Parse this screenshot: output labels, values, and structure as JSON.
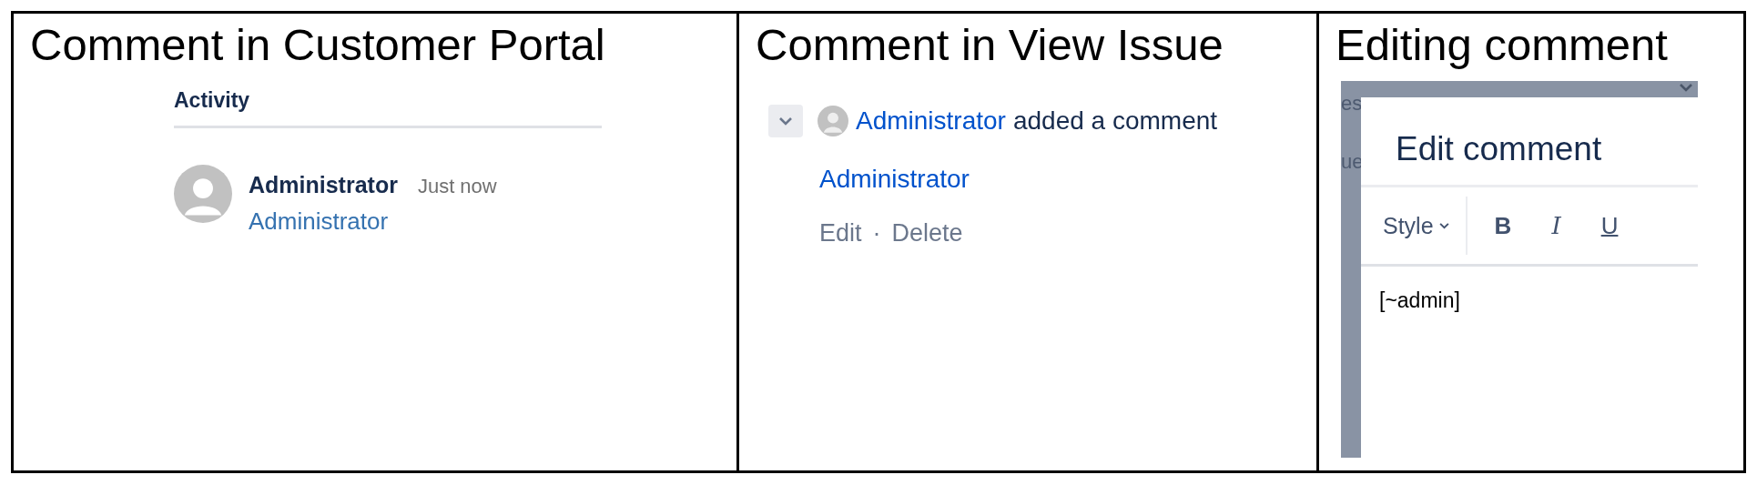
{
  "panels": [
    {
      "kind": "portal",
      "heading": "Comment in Customer Portal",
      "section_title": "Activity",
      "author": "Administrator",
      "time": "Just now",
      "body_link": "Administrator"
    },
    {
      "kind": "issue",
      "heading": "Comment in View Issue",
      "author": "Administrator",
      "action": "added a comment",
      "body_link": "Administrator",
      "actions": [
        "Edit",
        "Delete"
      ],
      "separator": "·"
    },
    {
      "kind": "editor",
      "heading": "Editing comment",
      "background_fragments": [
        "es",
        "ue"
      ],
      "dialog_title": "Edit comment",
      "style_label": "Style",
      "format_buttons": [
        {
          "label": "B",
          "kind": "bold"
        },
        {
          "label": "I",
          "kind": "italic"
        },
        {
          "label": "U",
          "kind": "underline"
        }
      ],
      "value": "[~admin]"
    }
  ]
}
